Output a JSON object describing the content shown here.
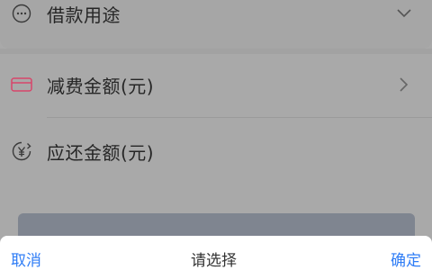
{
  "form": {
    "purpose": {
      "label": "借款用途",
      "icon": "more-dots-icon",
      "chevron": "chevron-down-icon"
    },
    "fee_reduction": {
      "label": "减费金额(元)",
      "icon": "coupon-icon",
      "chevron": "chevron-right-icon"
    },
    "repay_amount": {
      "label": "应还金额(元)",
      "icon": "yen-refresh-icon"
    }
  },
  "picker": {
    "cancel_label": "取消",
    "title": "请选择",
    "confirm_label": "确定"
  },
  "colors": {
    "overlay": "#a9a9a9",
    "accent": "#2f7df6",
    "coupon_icon": "#e0466a",
    "button": "#7f8590"
  }
}
